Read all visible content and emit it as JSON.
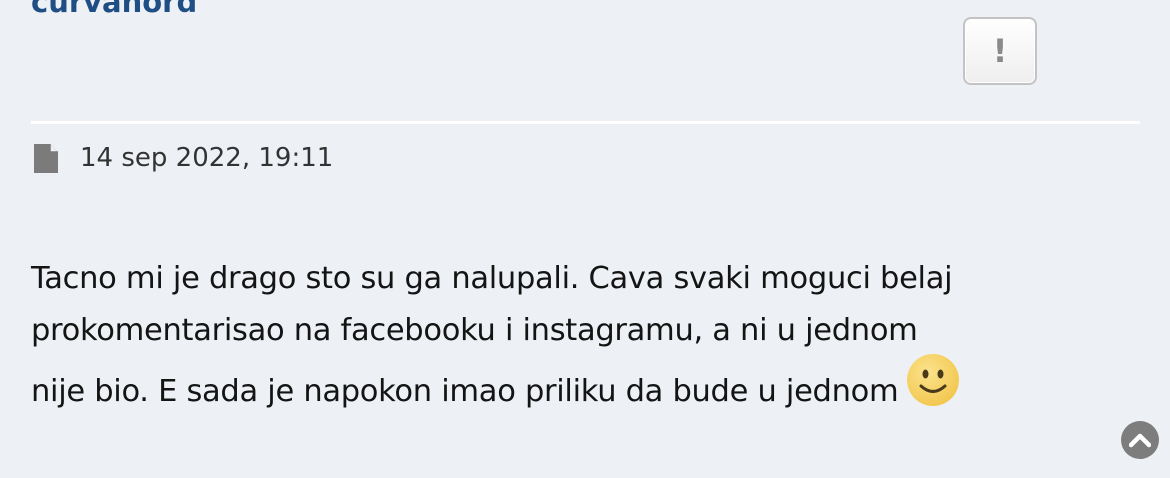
{
  "post": {
    "author": "curvanord",
    "report_label": "!",
    "date": "14 sep 2022, 19:11",
    "body_lines": [
      "Tacno mi je drago sto su ga nalupali. Cava svaki moguci belaj",
      "prokomentarisao na facebooku i instagramu, a ni u jednom",
      "nije bio. E sada je napokon imao priliku da bude u jednom"
    ],
    "smiley_icon": "smile-emoji-icon"
  },
  "colors": {
    "background": "#edf1f5",
    "username": "#1f4e84",
    "text": "#141414",
    "date": "#333333",
    "icon_gray": "#7d7d7d"
  },
  "icons": {
    "post_icon": "document-icon",
    "report_icon": "exclamation-icon",
    "scroll_top_icon": "chevron-up-circle-icon"
  }
}
